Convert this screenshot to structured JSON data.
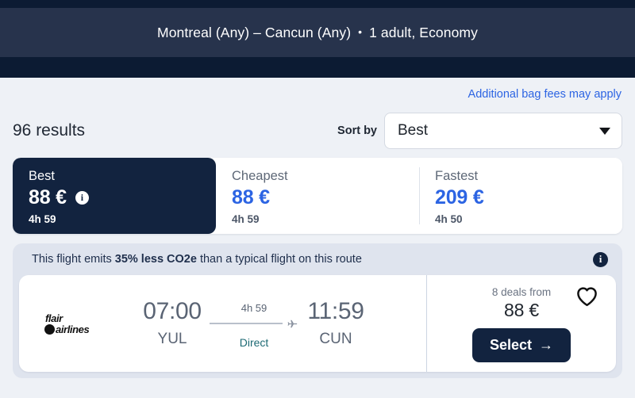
{
  "header": {
    "route_summary": "Montreal (Any) – Cancun (Any)",
    "separator": "•",
    "passengers": "1 adult, Economy"
  },
  "toolbar": {
    "bag_fees_link": "Additional bag fees may apply",
    "results_count": "96 results",
    "sort_label": "Sort by",
    "sort_value": "Best",
    "chevron_icon": "chevron-down-icon"
  },
  "tabs": [
    {
      "label": "Best",
      "price": "88 €",
      "duration": "4h 59",
      "selected": true,
      "info_icon": "info-icon",
      "info_glyph": "i"
    },
    {
      "label": "Cheapest",
      "price": "88 €",
      "duration": "4h 59",
      "selected": false
    },
    {
      "label": "Fastest",
      "price": "209 €",
      "duration": "4h 50",
      "selected": false
    }
  ],
  "eco_banner": {
    "text_before": "This flight emits ",
    "text_highlight": "35% less CO2e",
    "text_after": " than a typical flight on this route",
    "info_icon": "info-icon",
    "info_glyph": "i"
  },
  "flight": {
    "airline_logo_top": "flair",
    "airline_logo_bottom": "airlines",
    "airline_name": "flair airlines",
    "depart_time": "07:00",
    "depart_code": "YUL",
    "duration": "4h 59",
    "stops": "Direct",
    "arrive_time": "11:59",
    "arrive_code": "CUN",
    "deals_label": "8 deals from",
    "deals_price": "88 €",
    "select_label": "Select",
    "select_arrow": "→",
    "favorite_icon": "heart-icon",
    "plane_icon": "airplane-icon"
  },
  "colors": {
    "brand_navy": "#12233f",
    "header_navy": "#27334c",
    "accent_blue": "#2c64e3",
    "teal": "#1d6a74",
    "page_bg": "#eef1f6",
    "eco_bg": "#dfe4ee"
  }
}
